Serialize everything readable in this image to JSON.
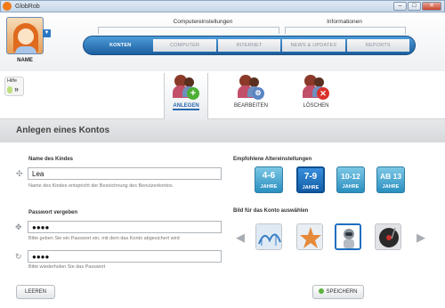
{
  "window": {
    "title": "GlobRob",
    "min": "–",
    "max": "□",
    "close": "✕"
  },
  "profile": {
    "name": "NAME",
    "dropdown": "▼"
  },
  "nav": {
    "group1": "Computereinstellungen",
    "group2": "Informationen",
    "tabs": [
      {
        "label": "KONTEN",
        "active": true
      },
      {
        "label": "COMPUTER"
      },
      {
        "label": "INTERNET"
      },
      {
        "label": "NEWS & UPDATES"
      },
      {
        "label": "REPORTS"
      }
    ]
  },
  "help": {
    "label": "Hilfe",
    "arrow": "»"
  },
  "toolbar": {
    "anlegen": "ANLEGEN",
    "bearbeiten": "BEARBEITEN",
    "loeschen": "LÖSCHEN"
  },
  "section_title": "Anlegen eines Kontos",
  "form": {
    "name_label": "Name des Kindes",
    "name_value": "Lea",
    "name_hint": "Name des Kindes entspricht der Bezeichnung des Benutzerkontos",
    "pw_label": "Passwort vergeben",
    "pw_value": "●●●●",
    "pw_hint": "Bitte geben Sie ein Passwort ein, mit dem das Konto abgesichert wird",
    "pw2_value": "●●●●",
    "pw2_hint": "Bitte wiederholen Sie das Passwort"
  },
  "age": {
    "label": "Empfohlene Altereinstellungen",
    "options": [
      {
        "range": "4-6",
        "unit": "JAHRE"
      },
      {
        "range": "7-9",
        "unit": "JAHRE",
        "selected": true
      },
      {
        "range": "10-12",
        "unit": "JAHRE"
      },
      {
        "range": "AB 13",
        "unit": "JAHRE"
      }
    ]
  },
  "images": {
    "label": "Bild für das Konto auswählen",
    "prev": "◀",
    "next": "▶"
  },
  "buttons": {
    "clear": "LEEREN",
    "save": "SPEICHERN"
  },
  "colors": {
    "accent": "#1f6fbf",
    "tab_active": "#2a6ab0",
    "add_badge": "#4caf34",
    "delete_badge": "#d9322b",
    "edit_badge": "#5b86c4"
  }
}
